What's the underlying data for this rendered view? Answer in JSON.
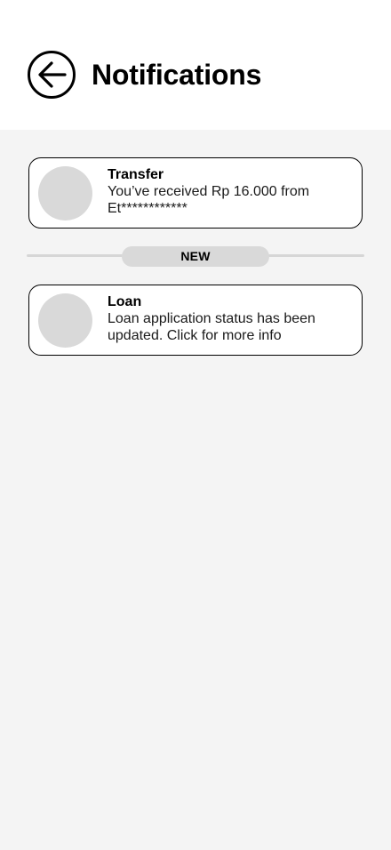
{
  "header": {
    "title": "Notifications",
    "back_icon": "arrow-left-icon"
  },
  "colors": {
    "header_bg": "#ffffff",
    "page_bg": "#f4f4f4",
    "avatar_placeholder": "#d9d9d9",
    "badge_bg": "#d9d9d9"
  },
  "notifications": [
    {
      "title": "Transfer",
      "message": "You’ve received Rp 16.000 from Et************"
    },
    {
      "title": "Loan",
      "message": "Loan application status has been updated. Click for more info"
    }
  ],
  "separator": {
    "label": "NEW"
  }
}
